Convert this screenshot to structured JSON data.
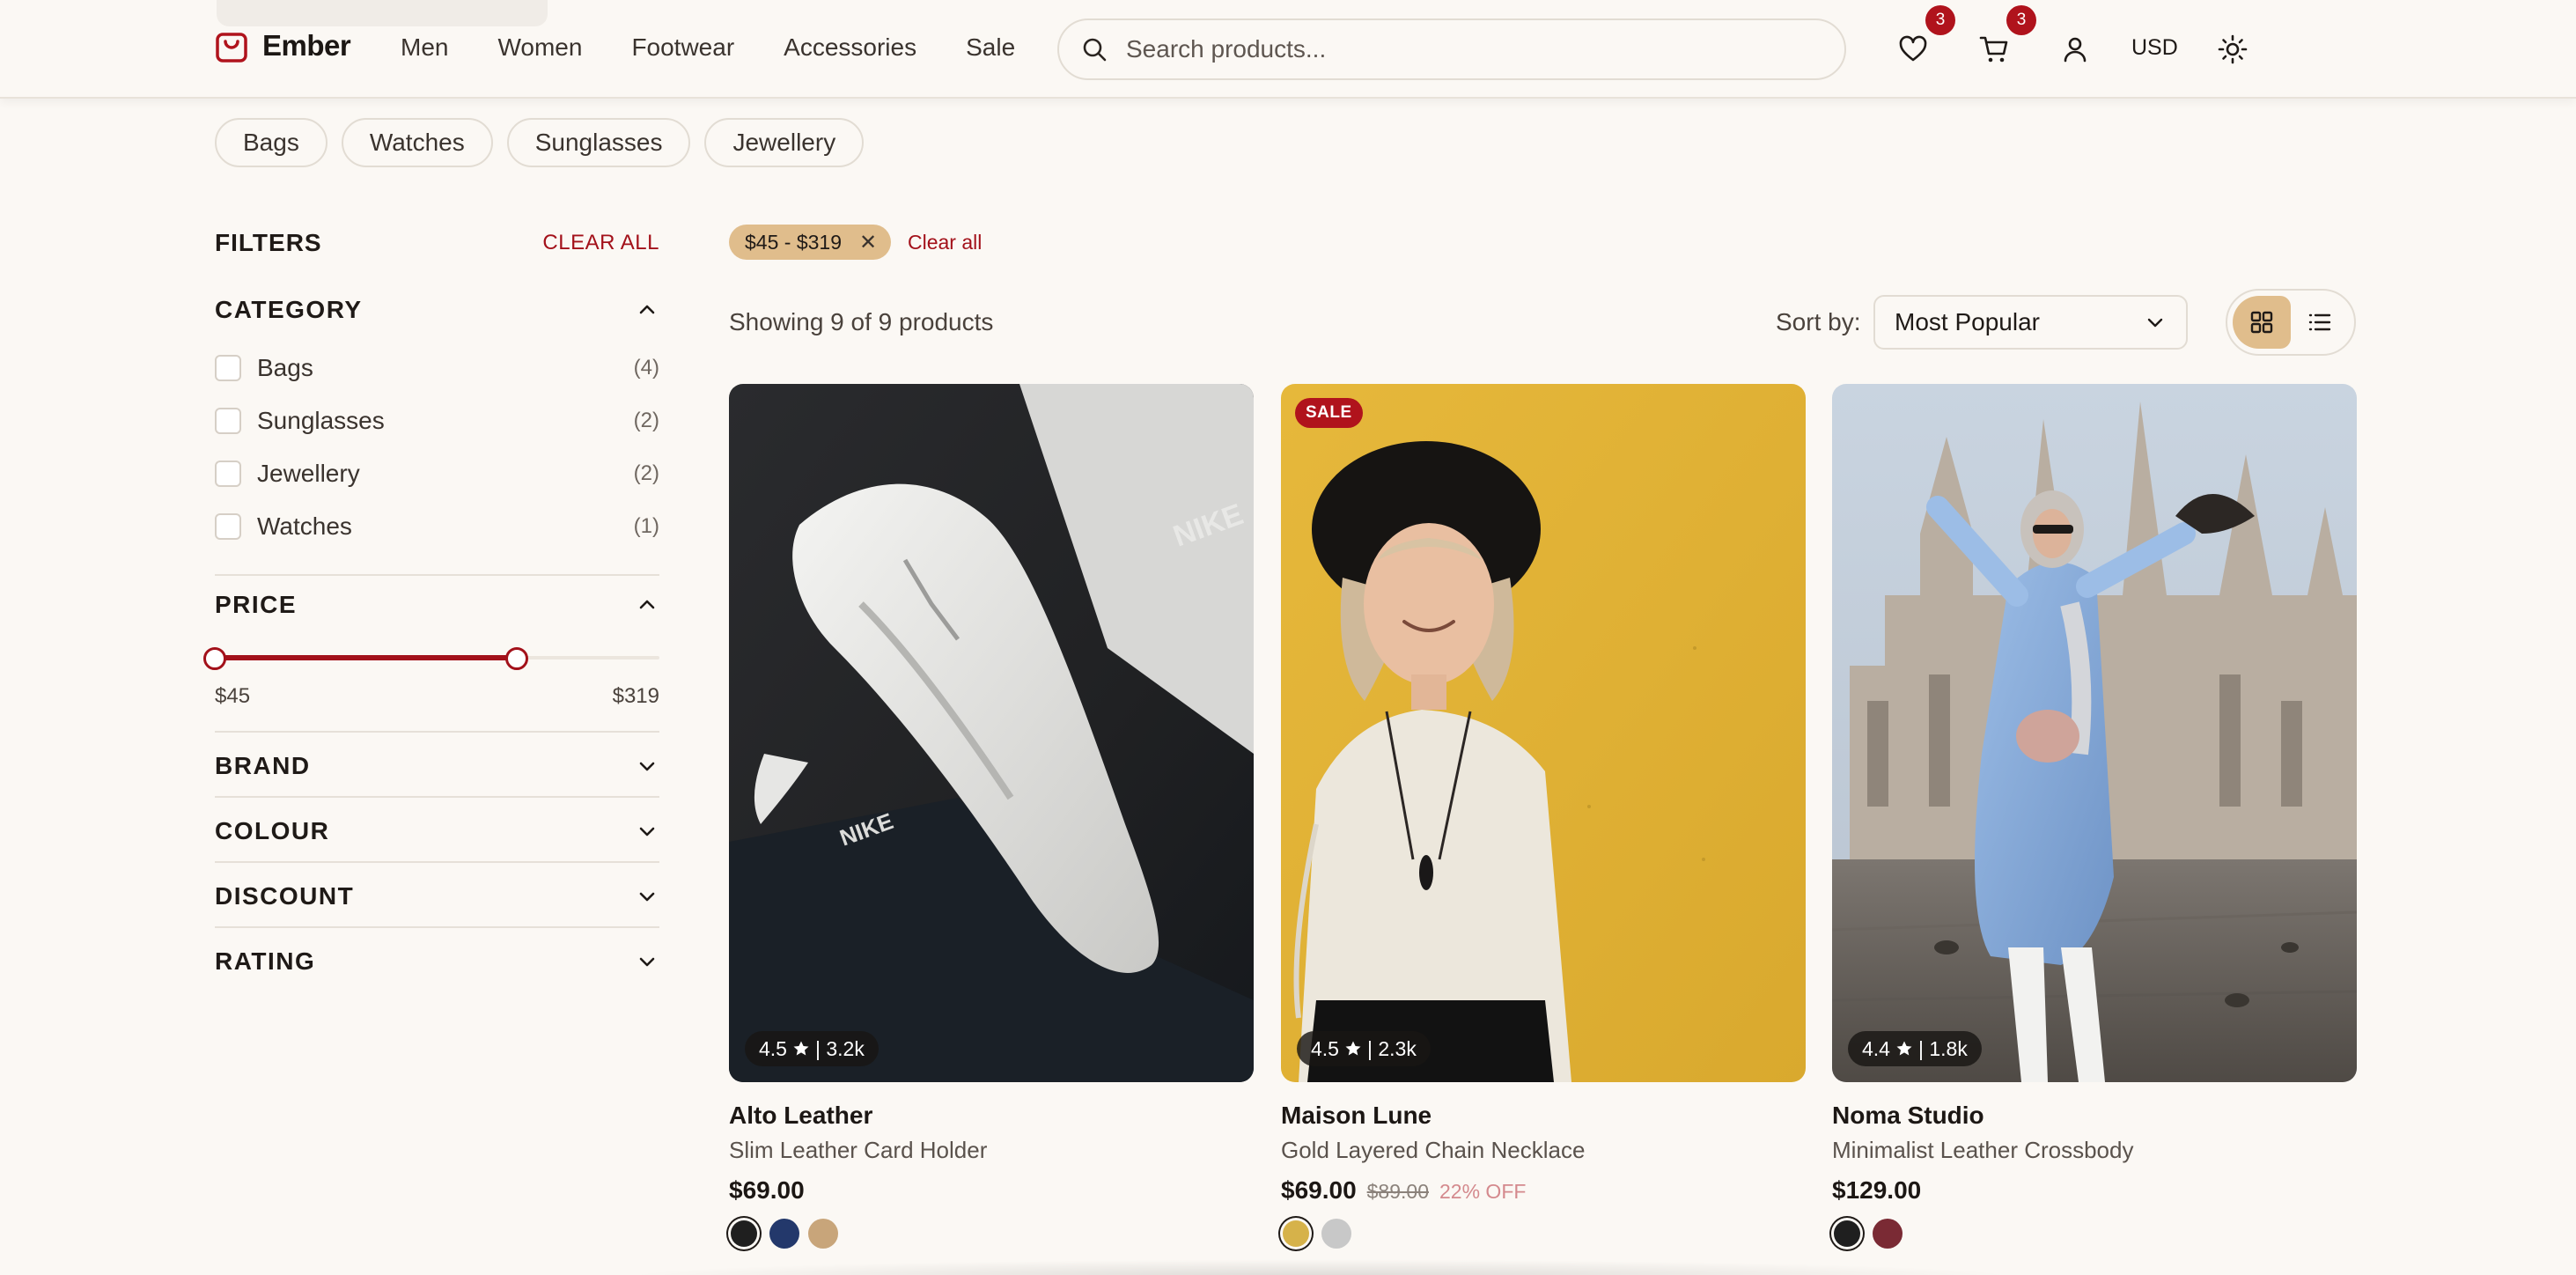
{
  "header": {
    "brand": "Ember",
    "nav": [
      "Men",
      "Women",
      "Footwear",
      "Accessories",
      "Sale"
    ],
    "search_placeholder": "Search products...",
    "wishlist_count": "3",
    "cart_count": "3",
    "currency": "USD"
  },
  "categories_chips": [
    "Bags",
    "Watches",
    "Sunglasses",
    "Jewellery"
  ],
  "filters": {
    "title": "FILTERS",
    "clear_all": "CLEAR ALL",
    "category": {
      "title": "CATEGORY",
      "items": [
        {
          "label": "Bags",
          "count": "(4)"
        },
        {
          "label": "Sunglasses",
          "count": "(2)"
        },
        {
          "label": "Jewellery",
          "count": "(2)"
        },
        {
          "label": "Watches",
          "count": "(1)"
        }
      ]
    },
    "price": {
      "title": "PRICE",
      "min_label": "$45",
      "max_label": "$319",
      "range_start_fraction": 0.0,
      "range_end_fraction": 0.68
    },
    "collapsed": [
      "BRAND",
      "COLOUR",
      "DISCOUNT",
      "RATING"
    ]
  },
  "active_filter": {
    "label": "$45 - $319",
    "remove": "✕",
    "clear_all": "Clear all"
  },
  "results": {
    "showing": "Showing 9 of 9 products",
    "sort_label": "Sort by:",
    "sort_value": "Most Popular"
  },
  "products": [
    {
      "brand": "Alto Leather",
      "name": "Slim Leather Card Holder",
      "price": "$69.00",
      "original_price": "",
      "discount": "",
      "rating": "4.5",
      "reviews": "| 3.2k",
      "sale": "",
      "image": "white-sneaker-photo",
      "swatches": [
        "#1f1f1f",
        "#23386b",
        "#c8a57a"
      ]
    },
    {
      "brand": "Maison Lune",
      "name": "Gold Layered Chain Necklace",
      "price": "$69.00",
      "original_price": "$89.00",
      "discount": "22% OFF",
      "rating": "4.5",
      "reviews": "| 2.3k",
      "sale": "SALE",
      "image": "woman-yellow-wall-photo",
      "swatches": [
        "#d6b24a",
        "#c8c8c8"
      ]
    },
    {
      "brand": "Noma Studio",
      "name": "Minimalist Leather Crossbody",
      "price": "$129.00",
      "original_price": "",
      "discount": "",
      "rating": "4.4",
      "reviews": "| 1.8k",
      "sale": "",
      "image": "woman-cathedral-photo",
      "swatches": [
        "#1f1f1f",
        "#7a2a34"
      ]
    }
  ],
  "colors": {
    "accent": "#a3111a",
    "badge": "#b0131c",
    "chip_active": "#e0bd8c",
    "background": "#fbf8f4"
  }
}
